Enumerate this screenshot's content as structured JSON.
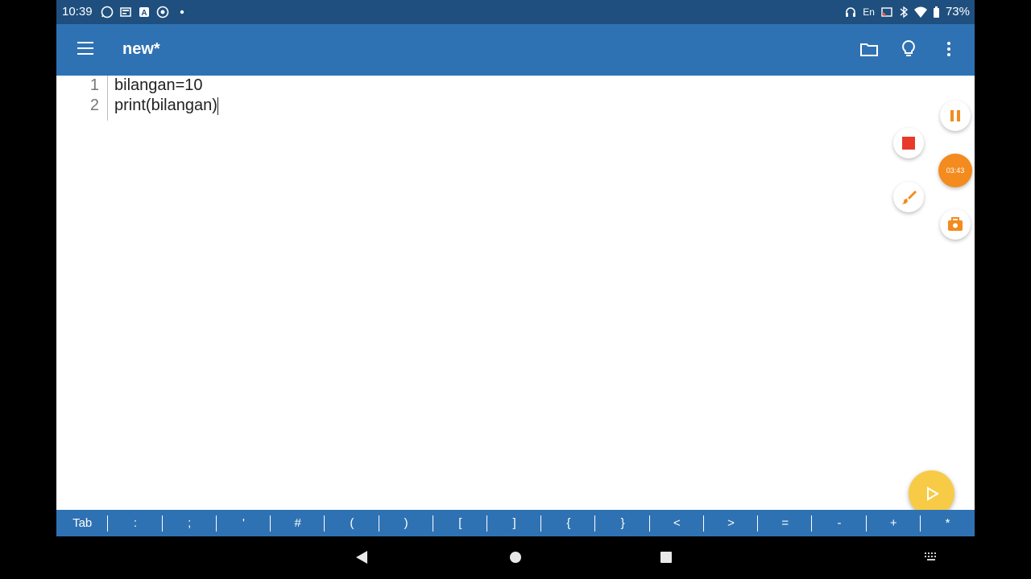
{
  "status_bar": {
    "time": "10:39",
    "language": "En",
    "battery": "73%"
  },
  "app_bar": {
    "title": "new*"
  },
  "editor": {
    "lines": [
      {
        "number": "1",
        "code": "bilangan=10"
      },
      {
        "number": "2",
        "code": "print(bilangan)"
      }
    ]
  },
  "recorder": {
    "timer": "03:43"
  },
  "symbol_bar": {
    "keys": [
      "Tab",
      ":",
      ";",
      "'",
      "#",
      "(",
      ")",
      "[",
      "]",
      "{",
      "}",
      "<",
      ">",
      "=",
      "-",
      "+",
      "*"
    ]
  },
  "colors": {
    "status_bar": "#1f4f7e",
    "app_bar": "#2f72b3",
    "recorder_orange": "#f38b1e",
    "run_button": "#f7cb46"
  }
}
